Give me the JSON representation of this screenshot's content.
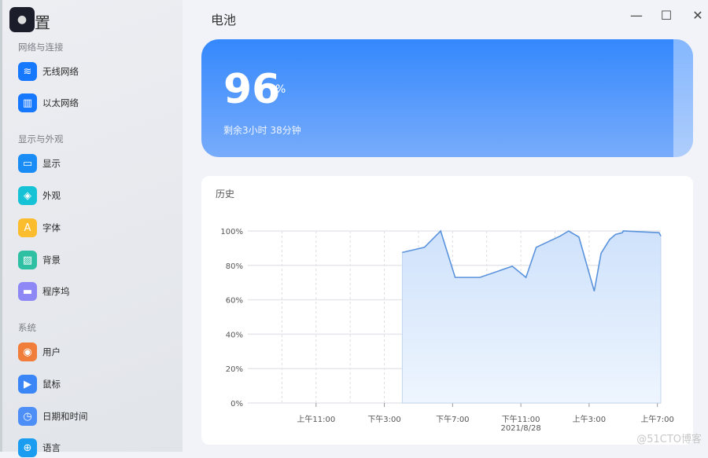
{
  "app": {
    "title": "置",
    "icon": "brain-icon"
  },
  "sidebar": {
    "sections": [
      {
        "label": "网络与连接",
        "items": [
          {
            "label": "无线网络",
            "icon": "wifi-icon",
            "color": "#1677ff"
          },
          {
            "label": "以太网络",
            "icon": "ethernet-icon",
            "color": "#1677ff"
          }
        ]
      },
      {
        "label": "显示与外观",
        "items": [
          {
            "label": "显示",
            "icon": "monitor-icon",
            "color": "#1a8cf5"
          },
          {
            "label": "外观",
            "icon": "layers-icon",
            "color": "#16c2d6"
          },
          {
            "label": "字体",
            "icon": "font-icon",
            "color": "#fbbd2e"
          },
          {
            "label": "背景",
            "icon": "image-icon",
            "color": "#2fc0a4"
          },
          {
            "label": "程序坞",
            "icon": "dock-icon",
            "color": "#8d88f5"
          }
        ]
      },
      {
        "label": "系统",
        "items": [
          {
            "label": "用户",
            "icon": "user-icon",
            "color": "#f07d3a"
          },
          {
            "label": "鼠标",
            "icon": "cursor-icon",
            "color": "#3b86f7"
          },
          {
            "label": "日期和时间",
            "icon": "clock-icon",
            "color": "#4d8ef7"
          },
          {
            "label": "语言",
            "icon": "globe-icon",
            "color": "#1a9cf0"
          }
        ]
      }
    ]
  },
  "header": {
    "title": "电池"
  },
  "battery": {
    "percent": "96",
    "unit": "%",
    "remaining": "剩余3小时 38分钟",
    "level": 0.96
  },
  "history": {
    "title": "历史"
  },
  "chart_data": {
    "type": "area",
    "ylim": [
      0,
      100
    ],
    "yticks": [
      "0%",
      "20%",
      "40%",
      "60%",
      "80%",
      "100%"
    ],
    "ytick_values": [
      0,
      20,
      40,
      60,
      80,
      100
    ],
    "xlim": [
      7,
      31.2
    ],
    "xticks": [
      {
        "x": 11,
        "label": "上午11:00"
      },
      {
        "x": 15,
        "label": "下午3:00"
      },
      {
        "x": 19,
        "label": "下午7:00"
      },
      {
        "x": 23,
        "label": "下午11:00",
        "sub": "2021/8/28"
      },
      {
        "x": 27,
        "label": "上午3:00"
      },
      {
        "x": 31,
        "label": "上午7:00"
      }
    ],
    "x_unit": "hours since 2021/8/27 00:00",
    "points": [
      [
        16.05,
        87.5
      ],
      [
        17.35,
        90.5
      ],
      [
        18.3,
        100
      ],
      [
        19.15,
        73
      ],
      [
        20.6,
        73
      ],
      [
        22.5,
        79.5
      ],
      [
        23.3,
        73
      ],
      [
        23.9,
        90.5
      ],
      [
        25.3,
        97
      ],
      [
        25.8,
        100
      ],
      [
        26.4,
        96.5
      ],
      [
        27.3,
        65
      ],
      [
        27.7,
        87
      ],
      [
        28.2,
        95
      ],
      [
        28.55,
        98
      ],
      [
        28.95,
        99
      ],
      [
        29.0,
        100
      ],
      [
        31.1,
        99
      ],
      [
        31.2,
        97
      ]
    ],
    "grid": true,
    "legend": "none"
  },
  "watermark": "@51CTO博客"
}
